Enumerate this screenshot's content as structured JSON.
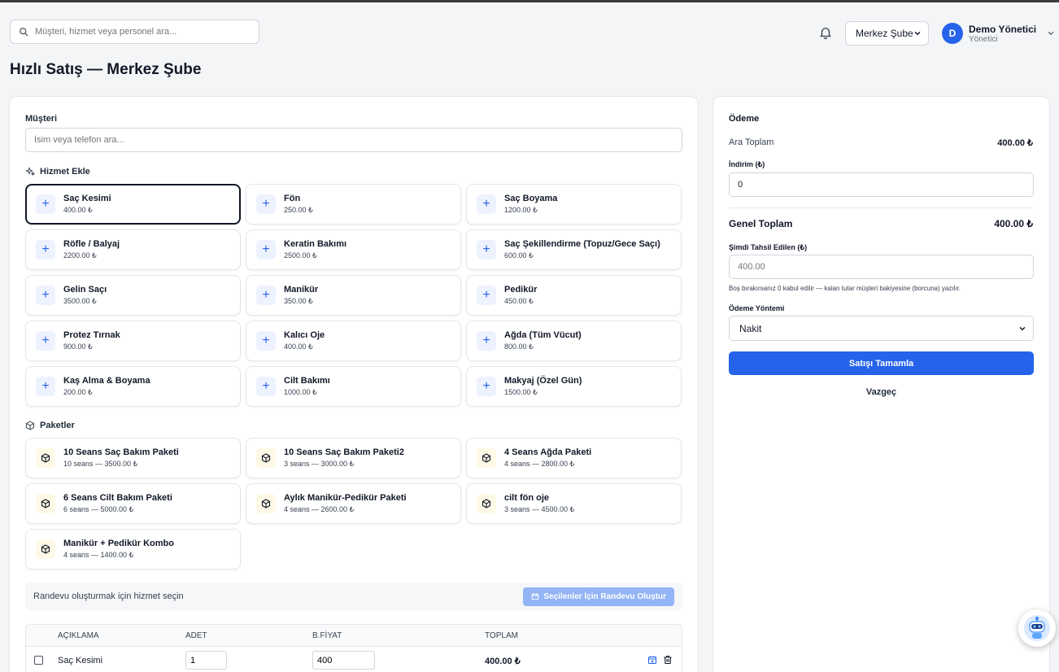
{
  "header": {
    "search_placeholder": "Müşteri, hizmet veya personel ara...",
    "branch": "Merkez Şube",
    "user_initial": "D",
    "user_name": "Demo Yönetici",
    "user_role": "Yönetici"
  },
  "page_title": "Hızlı Satış — Merkez Şube",
  "customer": {
    "label": "Müşteri",
    "placeholder": "İsim veya telefon ara..."
  },
  "services": {
    "label": "Hizmet Ekle",
    "items": [
      {
        "name": "Saç Kesimi",
        "price": "400.00 ₺"
      },
      {
        "name": "Fön",
        "price": "250.00 ₺"
      },
      {
        "name": "Saç Boyama",
        "price": "1200.00 ₺"
      },
      {
        "name": "Röfle / Balyaj",
        "price": "2200.00 ₺"
      },
      {
        "name": "Keratin Bakımı",
        "price": "2500.00 ₺"
      },
      {
        "name": "Saç Şekillendirme (Topuz/Gece Saçı)",
        "price": "600.00 ₺"
      },
      {
        "name": "Gelin Saçı",
        "price": "3500.00 ₺"
      },
      {
        "name": "Manikür",
        "price": "350.00 ₺"
      },
      {
        "name": "Pedikür",
        "price": "450.00 ₺"
      },
      {
        "name": "Protez Tırnak",
        "price": "900.00 ₺"
      },
      {
        "name": "Kalıcı Oje",
        "price": "400.00 ₺"
      },
      {
        "name": "Ağda (Tüm Vücut)",
        "price": "800.00 ₺"
      },
      {
        "name": "Kaş Alma & Boyama",
        "price": "200.00 ₺"
      },
      {
        "name": "Cilt Bakımı",
        "price": "1000.00 ₺"
      },
      {
        "name": "Makyaj (Özel Gün)",
        "price": "1500.00 ₺"
      }
    ]
  },
  "packages": {
    "label": "Paketler",
    "items": [
      {
        "name": "10 Seans Saç Bakım Paketi",
        "detail": "10 seans — 3500.00 ₺"
      },
      {
        "name": "10 Seans Saç Bakım Paketi2",
        "detail": "3 seans — 3000.00 ₺"
      },
      {
        "name": "4 Seans Ağda Paketi",
        "detail": "4 seans — 2800.00 ₺"
      },
      {
        "name": "6 Seans Cilt Bakım Paketi",
        "detail": "6 seans — 5000.00 ₺"
      },
      {
        "name": "Aylık Manikür-Pedikür Paketi",
        "detail": "4 seans — 2600.00 ₺"
      },
      {
        "name": "cilt fön oje",
        "detail": "3 seans — 4500.00 ₺"
      },
      {
        "name": "Manikür + Pedikür Kombo",
        "detail": "4 seans — 1400.00 ₺"
      }
    ]
  },
  "appointment": {
    "hint": "Randevu oluşturmak için hizmet seçin",
    "button": "Seçilenler İçin Randevu Oluştur"
  },
  "cart": {
    "columns": [
      "AÇIKLAMA",
      "ADET",
      "B.FİYAT",
      "TOPLAM"
    ],
    "rows": [
      {
        "description": "Saç Kesimi",
        "qty": "1",
        "unit_price": "400",
        "total": "400.00 ₺"
      }
    ]
  },
  "payment": {
    "title": "Ödeme",
    "subtotal_label": "Ara Toplam",
    "subtotal": "400.00 ₺",
    "discount_label": "İndirim (₺)",
    "discount_value": "0",
    "grand_total_label": "Genel Toplam",
    "grand_total": "400.00 ₺",
    "collected_label": "Şimdi Tahsil Edilen (₺)",
    "collected_placeholder": "400.00",
    "collected_hint": "Boş bırakırsanız 0 kabul edilir — kalan tutar müşteri bakiyesine (borcuna) yazılır.",
    "method_label": "Ödeme Yöntemi",
    "method_value": "Nakit",
    "complete_button": "Satışı Tamamla",
    "cancel_button": "Vazgeç"
  },
  "colors": {
    "primary": "#2563eb",
    "primary_disabled": "#93b4f5",
    "package_icon_bg": "#fef9e7"
  }
}
